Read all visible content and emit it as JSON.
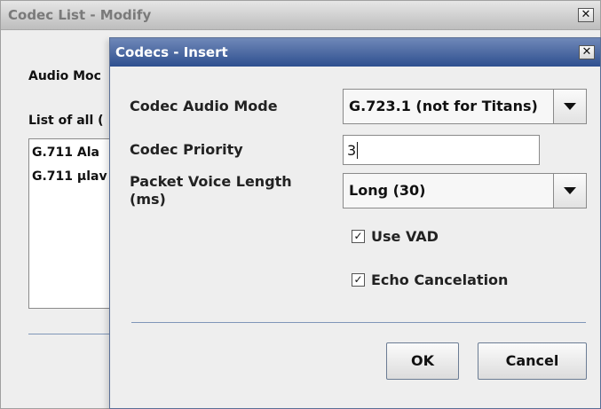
{
  "background_window": {
    "title": "Codec List - Modify",
    "close_glyph": "✕",
    "audio_mode_label_partial": "Audio Moc",
    "list_label_partial": "List of all (",
    "list_items": [
      "G.711 Ala",
      "G.711 µlav"
    ]
  },
  "dialog": {
    "title": "Codecs - Insert",
    "close_glyph": "✕",
    "codec_audio_mode": {
      "label": "Codec Audio Mode",
      "value": "G.723.1 (not for Titans)"
    },
    "codec_priority": {
      "label": "Codec Priority",
      "value": "3"
    },
    "packet_voice_length": {
      "label_line1": "Packet Voice Length",
      "label_line2": "(ms)",
      "value": "Long (30)"
    },
    "use_vad": {
      "label": "Use VAD",
      "checked": true,
      "glyph": "✓"
    },
    "echo_cancelation": {
      "label": "Echo Cancelation",
      "checked": true,
      "glyph": "✓"
    },
    "buttons": {
      "ok": "OK",
      "cancel": "Cancel"
    }
  },
  "colors": {
    "dialog_titlebar": "#2e4f8f",
    "window_background": "#eeeeee",
    "separator": "#7f96b8"
  }
}
